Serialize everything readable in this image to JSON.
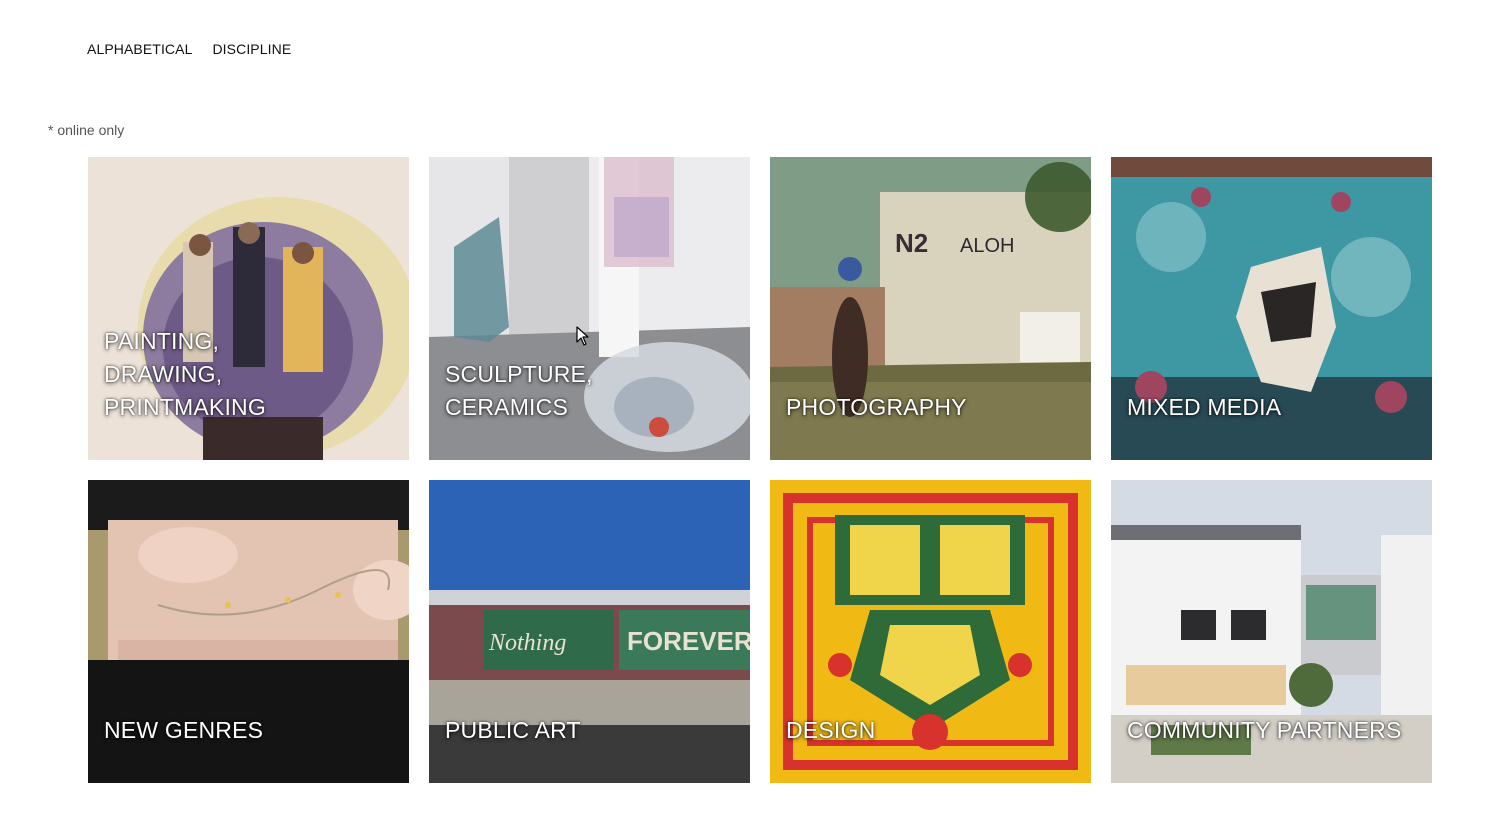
{
  "nav": {
    "items": [
      {
        "label": "ALPHABETICAL"
      },
      {
        "label": "DISCIPLINE"
      }
    ]
  },
  "note": "* online only",
  "tiles": [
    {
      "label": "PAINTING,\nDRAWING,\nPRINTMAKING",
      "palette": [
        "#e9dfd6",
        "#8e7a9a",
        "#5d4a6a"
      ]
    },
    {
      "label": "SCULPTURE,\nCERAMICS",
      "palette": [
        "#a9a9ab",
        "#7b7c80",
        "#d7d7d9"
      ]
    },
    {
      "label": "PHOTOGRAPHY",
      "palette": [
        "#7f8f76",
        "#a89d6c",
        "#55573c"
      ]
    },
    {
      "label": "MIXED MEDIA",
      "palette": [
        "#3f9ea8",
        "#8a3d54",
        "#20363c"
      ]
    },
    {
      "label": "NEW GENRES",
      "palette": [
        "#d9b9a8",
        "#1a1a1a",
        "#a99070"
      ]
    },
    {
      "label": "PUBLIC ART",
      "palette": [
        "#2f5fb1",
        "#7a5150",
        "#4b4b4b"
      ]
    },
    {
      "label": "DESIGN",
      "palette": [
        "#f1bd1a",
        "#d8352a",
        "#2f6b3a"
      ]
    },
    {
      "label": "COMMUNITY PARTNERS",
      "palette": [
        "#d8dde3",
        "#f4f4f4",
        "#7c8a6f"
      ]
    }
  ]
}
